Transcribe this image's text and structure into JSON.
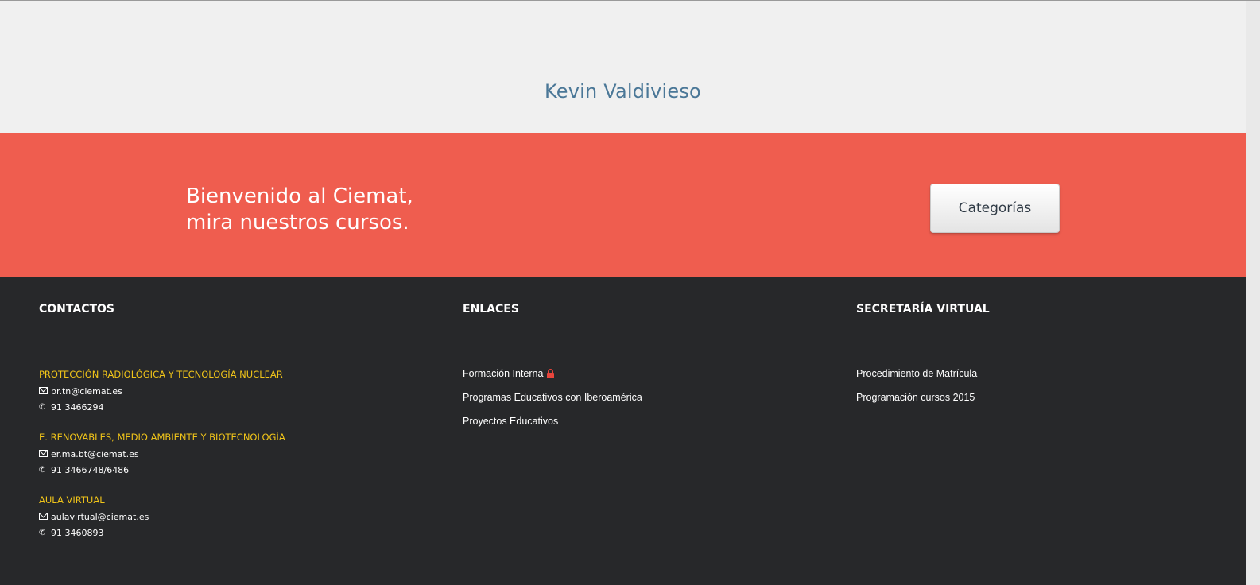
{
  "user": {
    "name": "Kevin Valdivieso"
  },
  "banner": {
    "line1": "Bienvenido al Ciemat,",
    "line2": "mira nuestros cursos.",
    "button_label": "Categorías",
    "background_color": "#ef5d4f"
  },
  "footer": {
    "contacts": {
      "title": "CONTACTOS",
      "groups": [
        {
          "title": "PROTECCIÓN RADIOLÓGICA Y TECNOLOGÍA NUCLEAR",
          "email": "pr.tn@ciemat.es",
          "phone": "91 3466294"
        },
        {
          "title": "E. RENOVABLES, MEDIO AMBIENTE Y BIOTECNOLOGÍA",
          "email": "er.ma.bt@ciemat.es",
          "phone": "91 3466748/6486"
        },
        {
          "title": "AULA VIRTUAL",
          "email": "aulavirtual@ciemat.es",
          "phone": "91 3460893"
        }
      ]
    },
    "links": {
      "title": "ENLACES",
      "items": [
        {
          "label": "Formación Interna",
          "icon": "lock-icon"
        },
        {
          "label": "Programas Educativos con Iberoamérica"
        },
        {
          "label": "Proyectos Educativos"
        }
      ]
    },
    "secretaria": {
      "title": "SECRETARÍA VIRTUAL",
      "items": [
        {
          "label": "Procedimiento de Matrícula"
        },
        {
          "label": "Programación cursos 2015"
        }
      ]
    },
    "colors": {
      "background": "#27282a",
      "group_title": "#f0c419",
      "lock": "#e8453c"
    }
  }
}
